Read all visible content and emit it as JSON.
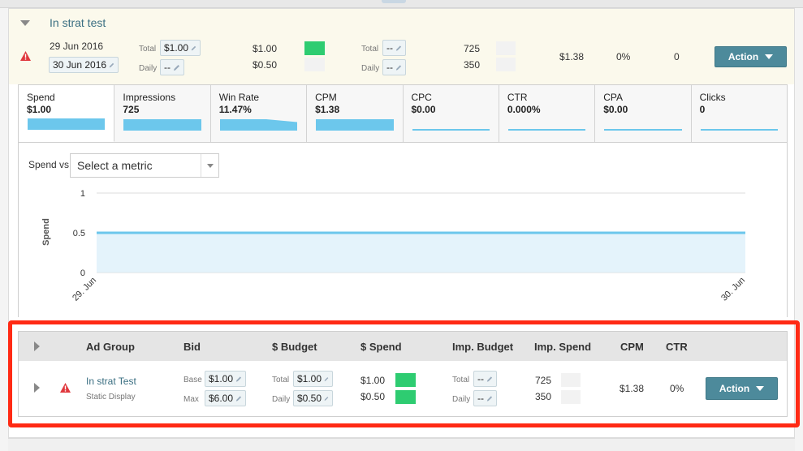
{
  "strategy": {
    "name": "In strat test",
    "start_date": "29 Jun 2016",
    "end_date": "30 Jun 2016",
    "budget": {
      "total_label": "Total",
      "daily_label": "Daily",
      "total_value": "$1.00",
      "daily_value": "--"
    },
    "spend": {
      "total": "$1.00",
      "daily": "$0.50",
      "total_color": "#2ecc71"
    },
    "imp_budget": {
      "total_label": "Total",
      "daily_label": "Daily",
      "total_value": "--",
      "daily_value": "--"
    },
    "impressions": {
      "total": "725",
      "daily": "350"
    },
    "cpm": "$1.38",
    "ctr": "0%",
    "clicks": "0",
    "action_label": "Action"
  },
  "metric_tabs": [
    {
      "label": "Spend",
      "value": "$1.00",
      "bar_fill": 1.0,
      "active": true
    },
    {
      "label": "Impressions",
      "value": "725",
      "bar_fill": 1.0
    },
    {
      "label": "Win Rate",
      "value": "11.47%",
      "bar_fill": 1.0
    },
    {
      "label": "CPM",
      "value": "$1.38",
      "bar_fill": 1.0
    },
    {
      "label": "CPC",
      "value": "$0.00",
      "bar_fill": 0.0
    },
    {
      "label": "CTR",
      "value": "0.000%",
      "bar_fill": 0.0
    },
    {
      "label": "CPA",
      "value": "$0.00",
      "bar_fill": 0.0
    },
    {
      "label": "Clicks",
      "value": "0",
      "bar_fill": 0.0
    }
  ],
  "compare": {
    "label": "Spend vs.",
    "placeholder": "Select a metric"
  },
  "chart_data": {
    "type": "area",
    "x": [
      "29. Jun",
      "30. Jun"
    ],
    "series": [
      {
        "values": [
          0.5,
          0.5
        ]
      }
    ],
    "ylabel": "Spend",
    "xlabel": "",
    "ylim": [
      0,
      1
    ],
    "yticks": [
      "1",
      "0.5",
      "0"
    ],
    "grid": true,
    "color": "#6cc7ec"
  },
  "ad_groups": {
    "headers": {
      "ad_group": "Ad Group",
      "bid": "Bid",
      "budget": "$ Budget",
      "spend": "$ Spend",
      "imp_budget": "Imp. Budget",
      "imp_spend": "Imp. Spend",
      "cpm": "CPM",
      "ctr": "CTR"
    },
    "rows": [
      {
        "name": "In strat Test",
        "type": "Static Display",
        "bid": {
          "base_label": "Base",
          "max_label": "Max",
          "base": "$1.00",
          "max": "$6.00"
        },
        "budget": {
          "total_label": "Total",
          "daily_label": "Daily",
          "total": "$1.00",
          "daily": "$0.50"
        },
        "spend": {
          "total": "$1.00",
          "daily": "$0.50"
        },
        "imp_budget": {
          "total_label": "Total",
          "daily_label": "Daily",
          "total": "--",
          "daily": "--"
        },
        "imp_spend": {
          "total": "725",
          "daily": "350"
        },
        "cpm": "$1.38",
        "ctr": "0%",
        "action_label": "Action"
      }
    ]
  },
  "colors": {
    "accent": "#4d8a9b",
    "highlight_frame": "#ff2a14",
    "chart_fill": "#d9eef9"
  }
}
